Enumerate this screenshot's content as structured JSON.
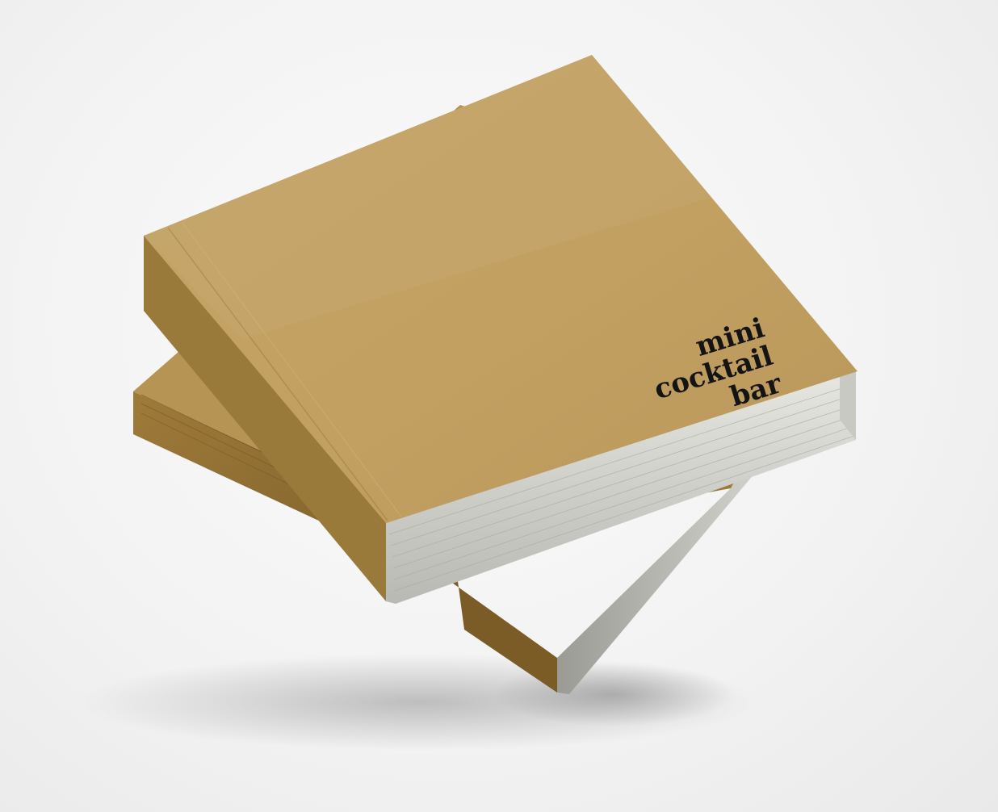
{
  "book_title": {
    "line1": "mini",
    "line2": "cocktail",
    "line3": "bar"
  },
  "colors": {
    "background": "#f3f3f3",
    "cover_kraft": "#c3a264",
    "cover_side_dark": "#8a6a30",
    "page_edges": "#dcdcd6",
    "title_ink": "#141414"
  }
}
